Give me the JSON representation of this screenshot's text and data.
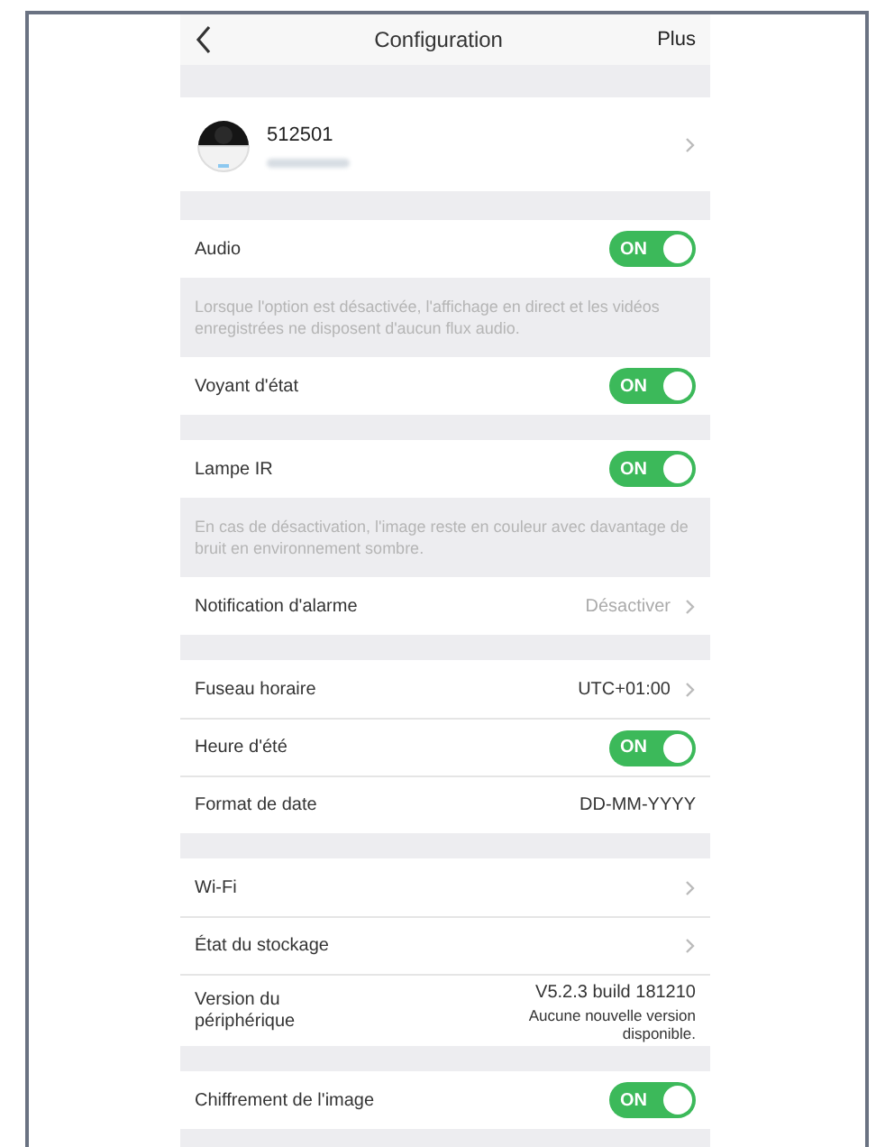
{
  "header": {
    "title": "Configuration",
    "action": "Plus"
  },
  "device": {
    "name": "512501"
  },
  "sections": [
    {
      "items": [
        {
          "kind": "toggle",
          "label": "Audio",
          "on": true,
          "toggle_text": "ON"
        }
      ],
      "note": "Lorsque l'option est désactivée, l'affichage en direct et les vidéos enregistrées ne disposent d'aucun flux audio."
    },
    {
      "items": [
        {
          "kind": "toggle",
          "label": "Voyant d'état",
          "on": true,
          "toggle_text": "ON"
        }
      ]
    },
    {
      "items": [
        {
          "kind": "toggle",
          "label": "Lampe IR",
          "on": true,
          "toggle_text": "ON"
        }
      ],
      "note": "En cas de désactivation, l'image reste en couleur avec davantage de bruit en environnement sombre."
    },
    {
      "items": [
        {
          "kind": "link",
          "label": "Notification d'alarme",
          "value": "Désactiver",
          "muted": true
        }
      ]
    },
    {
      "items": [
        {
          "kind": "link",
          "label": "Fuseau horaire",
          "value": "UTC+01:00",
          "muted": false
        },
        {
          "kind": "toggle",
          "label": "Heure d'été",
          "on": true,
          "toggle_text": "ON"
        },
        {
          "kind": "value",
          "label": "Format de date",
          "value": "DD-MM-YYYY"
        }
      ]
    },
    {
      "items": [
        {
          "kind": "link",
          "label": "Wi-Fi"
        },
        {
          "kind": "link",
          "label": "État du stockage"
        },
        {
          "kind": "version",
          "label": "Version du périphérique",
          "value": "V5.2.3 build 181210",
          "detail": "Aucune nouvelle version disponible."
        }
      ]
    },
    {
      "items": [
        {
          "kind": "toggle",
          "label": "Chiffrement de l'image",
          "on": true,
          "toggle_text": "ON"
        }
      ]
    }
  ]
}
